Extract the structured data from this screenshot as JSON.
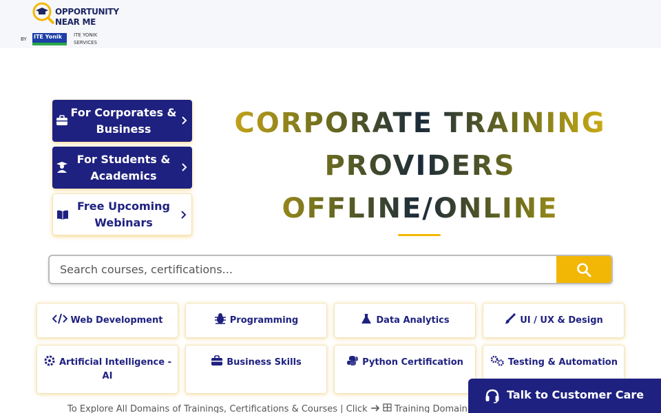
{
  "header": {
    "logo_title_line1": "OPPORTUNITY",
    "logo_title_line2": "NEAR ME",
    "logo_by": "BY",
    "logo_brand": "ITE Yonik",
    "logo_brand_sub_line1": "ITE YONIK",
    "logo_brand_sub_line2": "SERVICES"
  },
  "side_buttons": [
    {
      "label": "For Corporates & Business",
      "icon": "briefcase-icon"
    },
    {
      "label": "For Students & Academics",
      "icon": "graduate-icon"
    },
    {
      "label": "Free Upcoming Webinars",
      "icon": "book-icon"
    }
  ],
  "headline": {
    "line1": "CORPORATE TRAINING",
    "line2": "PROVIDERS",
    "line3": "OFFLINE/ONLINE"
  },
  "search": {
    "placeholder": "Search courses, certifications..."
  },
  "categories": [
    {
      "label": "Web Development",
      "icon": "code-icon"
    },
    {
      "label": "Programming",
      "icon": "bug-icon"
    },
    {
      "label": "Data Analytics",
      "icon": "flask-icon"
    },
    {
      "label": "UI / UX & Design",
      "icon": "brush-icon"
    },
    {
      "label": "Artificial Intelligence - AI",
      "icon": "gear-icon"
    },
    {
      "label": "Business Skills",
      "icon": "briefcase-icon"
    },
    {
      "label": "Python Certification",
      "icon": "python-icon"
    },
    {
      "label": "Testing & Automation",
      "icon": "gears-icon"
    }
  ],
  "explore": {
    "text": "To Explore All Domains of Trainings, Certifications & Courses | Click",
    "link": "Training Domain"
  },
  "care": {
    "label": "Talk to Customer Care"
  },
  "colors": {
    "navy": "#1f2180",
    "gold": "#f2b705"
  }
}
